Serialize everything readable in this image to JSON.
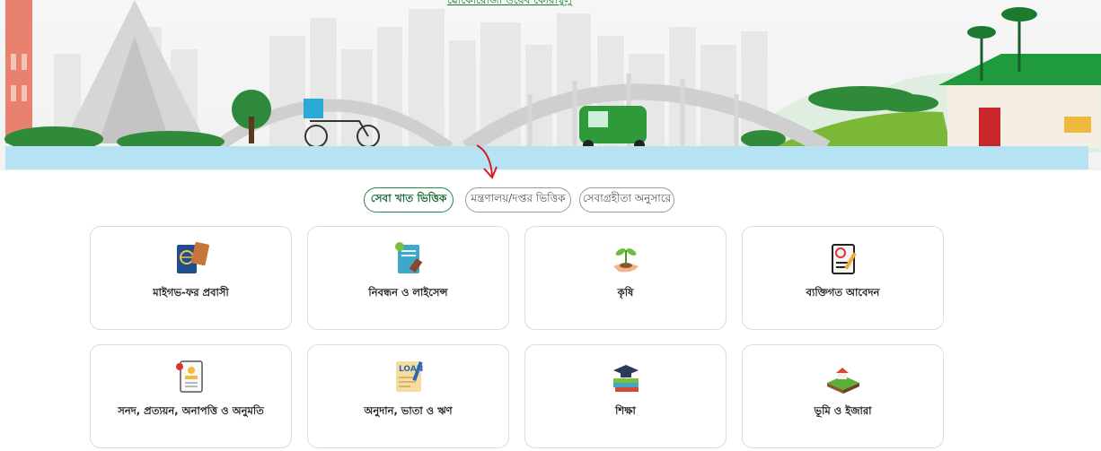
{
  "header": {
    "top_link": "ৱোকোরোজা ওয়েব কোরাম্বুলু"
  },
  "filters": [
    {
      "label": "সেবা খাত ভিত্তিক",
      "active": true
    },
    {
      "label": "মন্ত্রণালয়/দপ্তর ভিত্তিক",
      "active": false
    },
    {
      "label": "সেবাগ্রহীতা অনুসারে",
      "active": false
    }
  ],
  "categories": [
    {
      "label": "মাইগভ-ফর প্রবাসী",
      "icon": "passport-icon"
    },
    {
      "label": "নিবন্ধন ও লাইসেন্স",
      "icon": "registration-license-icon"
    },
    {
      "label": "কৃষি",
      "icon": "plant-hand-icon"
    },
    {
      "label": "ব্যক্তিগত আবেদন",
      "icon": "personal-application-icon"
    },
    {
      "label": "সনদ, প্রত্যয়ন, অনাপত্তি ও অনুমতি",
      "icon": "certificate-icon"
    },
    {
      "label": "অনুদান, ভাতা ও ঋণ",
      "icon": "loan-icon"
    },
    {
      "label": "শিক্ষা",
      "icon": "education-icon"
    },
    {
      "label": "ভূমি ও ইজারা",
      "icon": "land-icon"
    }
  ],
  "icon_texts": {
    "loan": "LOAN"
  },
  "colors": {
    "accent_green": "#1f8a4c",
    "water": "#b6e3f3",
    "arrow_red": "#d11f1f"
  }
}
